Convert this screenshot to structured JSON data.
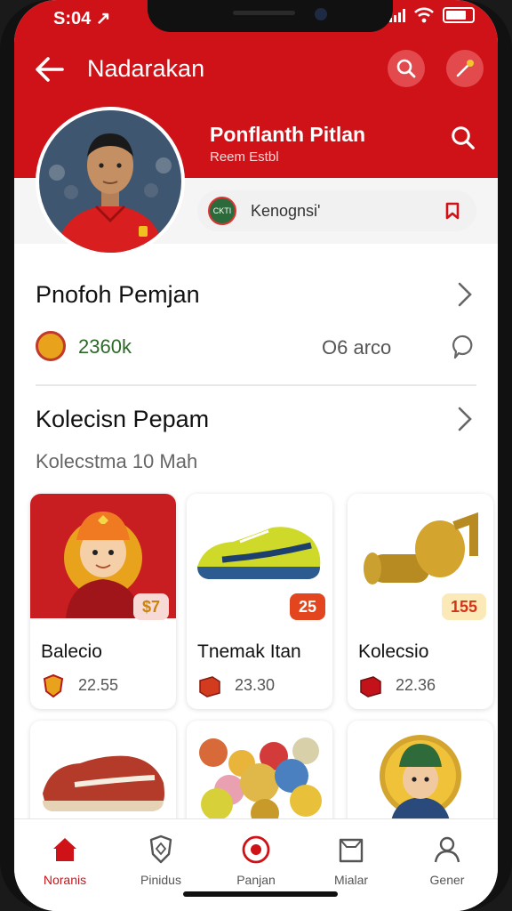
{
  "status": {
    "time": "S:04 ↗"
  },
  "header": {
    "title": "Nadarakan"
  },
  "profile": {
    "name": "Ponflanth Pitlan",
    "subtitle": "Reem Estbl"
  },
  "club": {
    "name": "Kenognsi'",
    "logo_text": "CKTI"
  },
  "section1": {
    "title": "Pnofoh Pemjan",
    "stat_value": "2360k",
    "stat_right": "O6 arco"
  },
  "section2": {
    "title": "Kolecisn Pepam",
    "subtitle": "Kolecstma 10 Mah"
  },
  "cards": [
    {
      "name": "Balecio",
      "price": "$7",
      "value": "22.55"
    },
    {
      "name": "Tnemak Itan",
      "price": "25",
      "value": "23.30"
    },
    {
      "name": "Kolecsio",
      "price": "155",
      "value": "22.36"
    }
  ],
  "tabs": [
    {
      "label": "Noranis"
    },
    {
      "label": "Pinidus"
    },
    {
      "label": "Panjan"
    },
    {
      "label": "Mialar"
    },
    {
      "label": "Gener"
    }
  ],
  "colors": {
    "brand": "#cf1218",
    "accent_gold": "#e8a21b"
  }
}
